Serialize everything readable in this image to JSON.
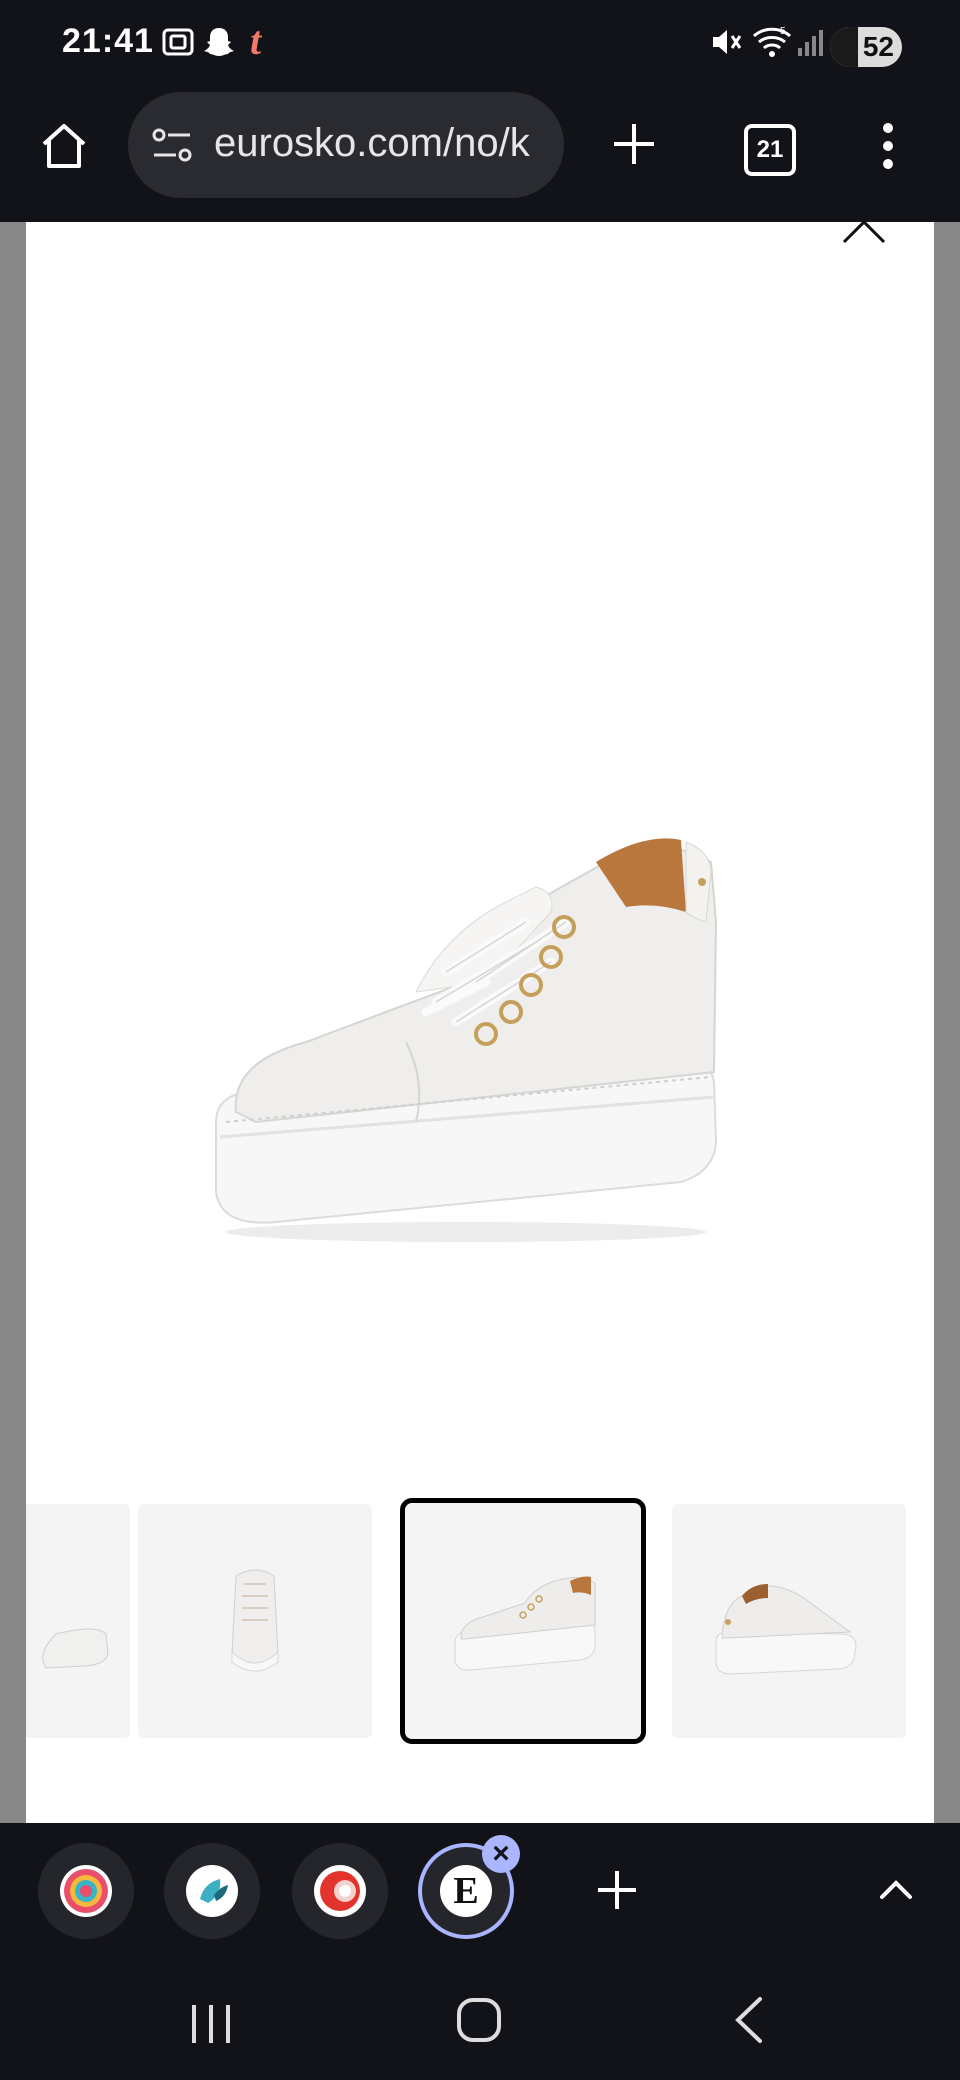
{
  "status_bar": {
    "time": "21:41",
    "battery_level": "52",
    "notification_icons": [
      "screenshot-icon",
      "snapchat-icon",
      "tumblr-icon"
    ],
    "system_icons": [
      "mute-icon",
      "wifi-icon",
      "signal-icon",
      "battery-icon"
    ]
  },
  "browser": {
    "url": "eurosko.com/no/k",
    "tab_count": "21"
  },
  "gallery": {
    "selected_index": 2,
    "thumbnails": [
      "partial-left-view",
      "front-view",
      "side-angle-view",
      "back-angle-view"
    ]
  },
  "dock": {
    "apps": [
      "target-app",
      "leaf-app",
      "red-app",
      "eurosko-app"
    ],
    "active_letter": "E"
  },
  "colors": {
    "system_bg": "#121318",
    "urlbar_bg": "#2a2b31",
    "accent": "#a8b4ff"
  }
}
